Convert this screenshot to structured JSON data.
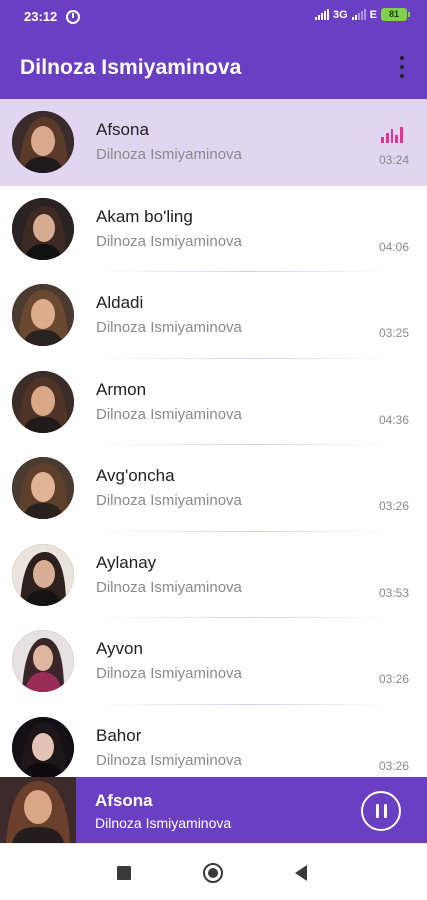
{
  "status_bar": {
    "time": "23:12",
    "alarm_icon": "alarm-clock-icon",
    "network": "3G",
    "network2": "E",
    "battery": "81"
  },
  "app_bar": {
    "title": "Dilnoza Ismiyaminova",
    "menu_icon": "more-vert-icon"
  },
  "colors": {
    "primary": "#6a3fc3",
    "active_row": "#e1d5f1",
    "playing_indicator": "#e8328f"
  },
  "songs": [
    {
      "title": "Afsona",
      "artist": "Dilnoza Ismiyaminova",
      "duration": "03:24",
      "playing": true
    },
    {
      "title": "Akam bo'ling",
      "artist": "Dilnoza Ismiyaminova",
      "duration": "04:06"
    },
    {
      "title": "Aldadi",
      "artist": "Dilnoza Ismiyaminova",
      "duration": "03:25"
    },
    {
      "title": "Armon",
      "artist": "Dilnoza Ismiyaminova",
      "duration": "04:36"
    },
    {
      "title": "Avg'oncha",
      "artist": "Dilnoza Ismiyaminova",
      "duration": "03:26"
    },
    {
      "title": "Aylanay",
      "artist": "Dilnoza Ismiyaminova",
      "duration": "03:53"
    },
    {
      "title": "Ayvon",
      "artist": "Dilnoza Ismiyaminova",
      "duration": "03:26"
    },
    {
      "title": "Bahor",
      "artist": "Dilnoza Ismiyaminova",
      "duration": "03:26"
    }
  ],
  "now_playing": {
    "title": "Afsona",
    "artist": "Dilnoza Ismiyaminova",
    "control_icon": "pause-icon"
  },
  "nav_bar": {
    "recents_icon": "square-recents-icon",
    "home_icon": "circle-home-icon",
    "back_icon": "triangle-back-icon"
  }
}
